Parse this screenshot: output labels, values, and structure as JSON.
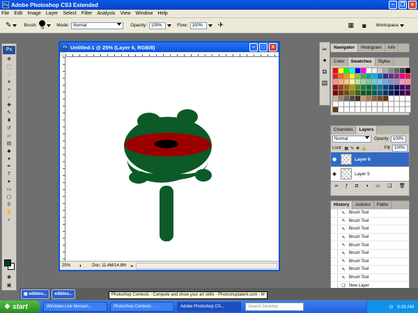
{
  "app": {
    "title": "Adobe Photoshop CS3 Extended",
    "logo": "Ps"
  },
  "menu": [
    "File",
    "Edit",
    "Image",
    "Layer",
    "Select",
    "Filter",
    "Analysis",
    "View",
    "Window",
    "Help"
  ],
  "options": {
    "brush_label": "Brush:",
    "brush_size": "70",
    "mode_label": "Mode:",
    "mode_value": "Normal",
    "opacity_label": "Opacity:",
    "opacity_value": "100%",
    "flow_label": "Flow:",
    "flow_value": "100%",
    "workspace": "Workspace"
  },
  "colors": {
    "foreground": "#003d1c",
    "background": "#ffffff",
    "body_green": "#0b5a27",
    "red_band": "#9b0000"
  },
  "document": {
    "title": "Untitled-1 @ 25% (Layer 6, RGB/8)",
    "zoom": "25%",
    "doc_info": "Doc: 11.4M/14.8M"
  },
  "panels": {
    "navigator_tabs": [
      "Navigator",
      "Histogram",
      "Info"
    ],
    "swatch_tabs": [
      "Color",
      "Swatches",
      "Styles"
    ],
    "layer_tabs": [
      "Channels",
      "Layers"
    ],
    "layers": {
      "blend_mode": "Normal",
      "opacity_label": "Opacity:",
      "opacity": "100%",
      "lock_label": "Lock:",
      "fill_label": "Fill:",
      "fill": "100%",
      "items": [
        {
          "name": "Layer 6",
          "selected": true
        },
        {
          "name": "Layer 5",
          "selected": false
        }
      ]
    },
    "history_tabs": [
      "History",
      "Actions",
      "Paths"
    ],
    "history": [
      "Brush Tool",
      "Brush Tool",
      "Brush Tool",
      "Brush Tool",
      "Brush Tool",
      "Brush Tool",
      "Brush Tool",
      "Brush Tool",
      "Brush Tool",
      "New Layer",
      "Brush Tool"
    ]
  },
  "minimized_docs": [
    "edibles...",
    "edibles..."
  ],
  "tooltip": "Photoshop Contests - Compete and show your art skills - Photoshoptalent.com - M",
  "taskbar": {
    "start": "start",
    "tasks": [
      "Windows Live Messen...",
      "Photoshop Contests - ...",
      "Adobe Photoshop CS..."
    ],
    "search_placeholder": "Search Desktop",
    "clock": "9:33 AM"
  }
}
